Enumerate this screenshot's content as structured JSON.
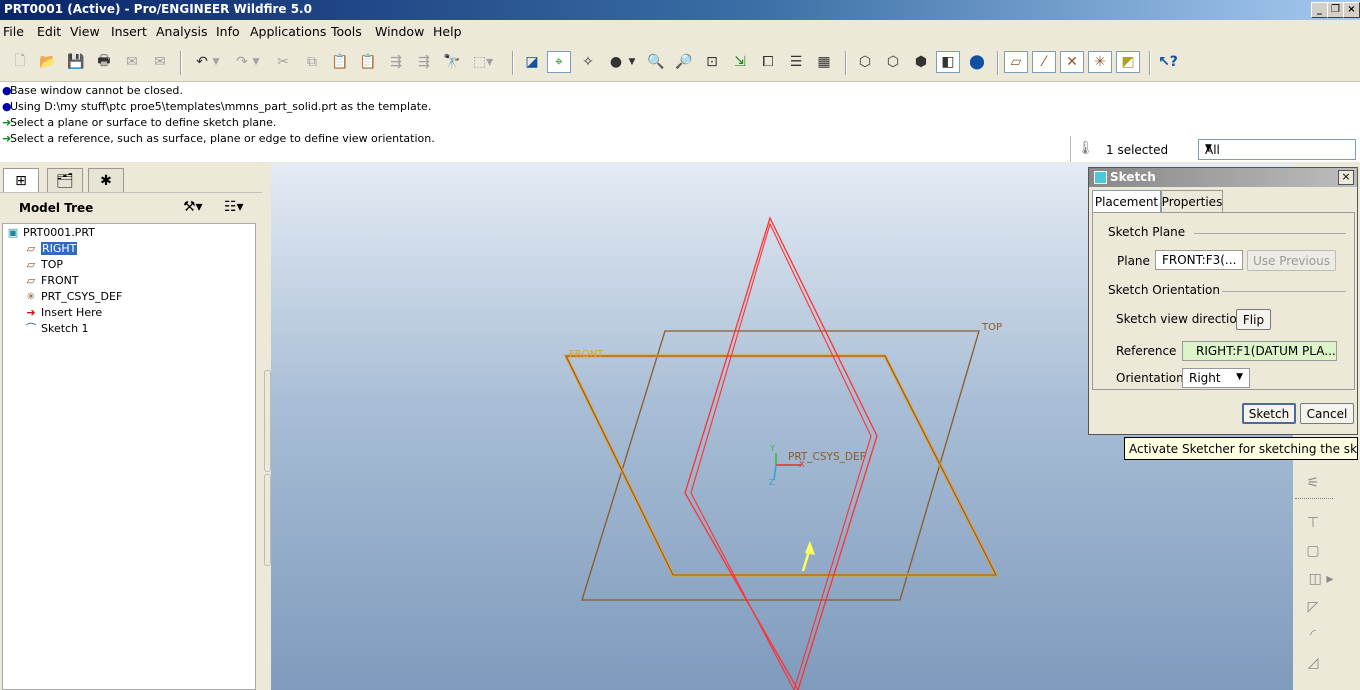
{
  "window": {
    "title": "PRT0001 (Active) - Pro/ENGINEER Wildfire 5.0"
  },
  "menu": [
    "File",
    "Edit",
    "View",
    "Insert",
    "Analysis",
    "Info",
    "Applications",
    "Tools",
    "Window",
    "Help"
  ],
  "messages": [
    {
      "kind": "info",
      "text": "Base window cannot be closed."
    },
    {
      "kind": "info",
      "text": "Using D:\\my stuff\\ptc proe5\\templates\\mmns_part_solid.prt as the template."
    },
    {
      "kind": "prompt",
      "text": "Select a plane or surface to define sketch plane."
    },
    {
      "kind": "prompt",
      "text": "Select a reference, such as surface, plane or edge to define view orientation."
    }
  ],
  "selection": {
    "count_text": "1 selected",
    "filter_value": "All"
  },
  "model_tree": {
    "title": "Model Tree",
    "nodes": [
      {
        "label": "PRT0001.PRT",
        "icon": "part-icon"
      },
      {
        "label": "RIGHT",
        "icon": "datum-plane-icon",
        "selected": true
      },
      {
        "label": "TOP",
        "icon": "datum-plane-icon"
      },
      {
        "label": "FRONT",
        "icon": "datum-plane-icon"
      },
      {
        "label": "PRT_CSYS_DEF",
        "icon": "csys-icon"
      },
      {
        "label": "Insert Here",
        "icon": "insert-arrow-icon"
      },
      {
        "label": "Sketch 1",
        "icon": "sketch-icon"
      }
    ]
  },
  "viewport": {
    "labels": {
      "front": "FRONT",
      "top": "TOP",
      "csys": "PRT_CSYS_DEF",
      "x": "X",
      "y": "Y",
      "z": "Z"
    },
    "colors": {
      "datum": "#8a5a2a",
      "selected": "#ff3030",
      "highlight": "#e8a030"
    }
  },
  "dialog": {
    "title": "Sketch",
    "tabs": [
      "Placement",
      "Properties"
    ],
    "sketch_plane_header": "Sketch Plane",
    "plane_label": "Plane",
    "plane_value": "FRONT:F3(...",
    "use_previous": "Use Previous",
    "orientation_header": "Sketch Orientation",
    "view_direction_label": "Sketch view direction",
    "flip": "Flip",
    "reference_label": "Reference",
    "reference_value": "RIGHT:F1(DATUM PLA...",
    "orientation_label": "Orientation",
    "orientation_value": "Right",
    "sketch_button": "Sketch",
    "cancel_button": "Cancel",
    "close": "×"
  },
  "tooltip": "Activate Sketcher for sketching the sketch."
}
